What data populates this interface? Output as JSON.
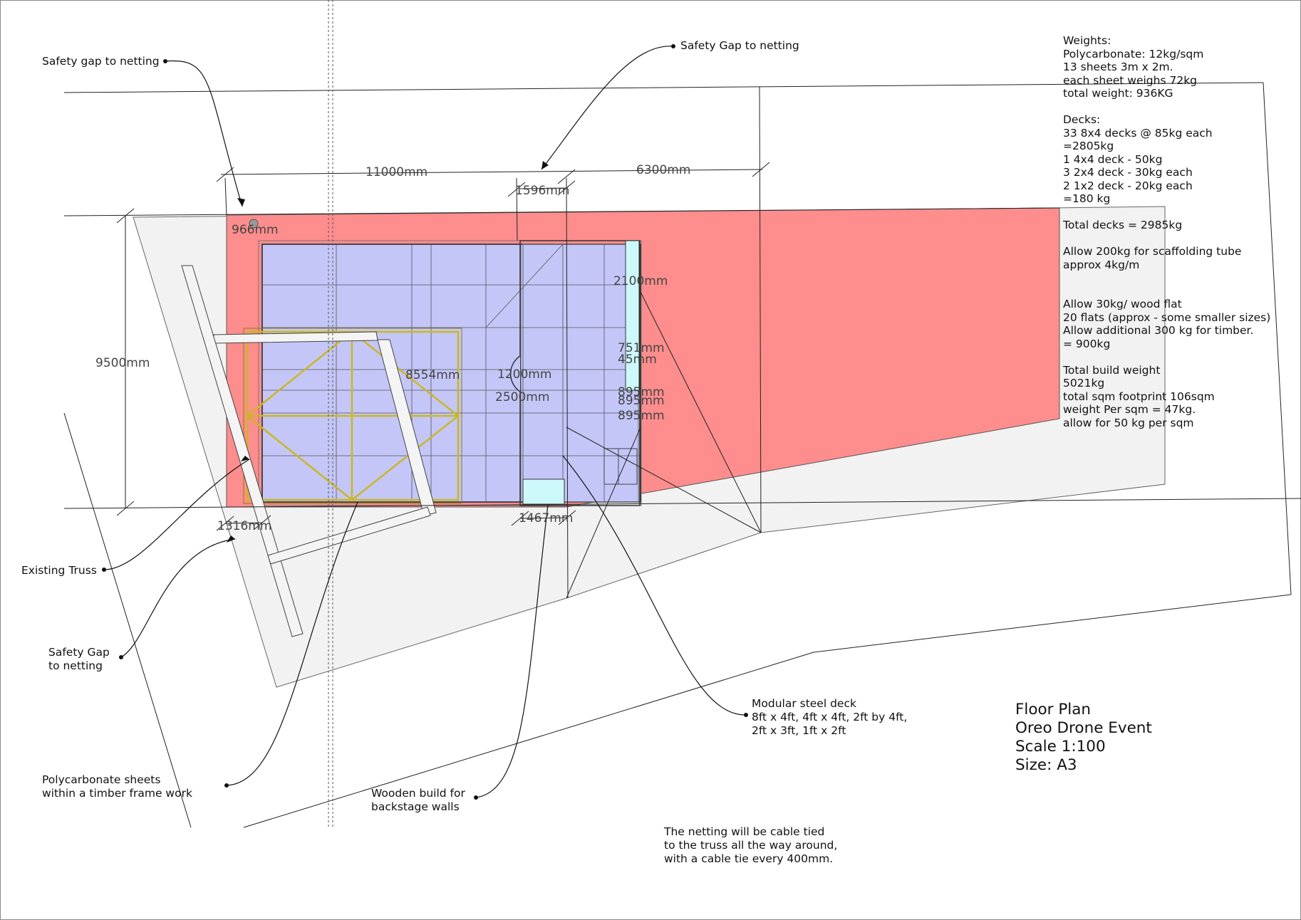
{
  "colors": {
    "deck": "#c4c6f8",
    "safety_zone": "#fe8d8d",
    "floor": "#f2f2f2",
    "truss": "#e8d84a",
    "cyan": "#ccf8fa"
  },
  "callouts": {
    "safety_gap_top_left": "Safety gap to netting",
    "safety_gap_top": "Safety Gap to netting",
    "existing_truss": "Existing Truss",
    "safety_gap_left_1": "Safety Gap",
    "safety_gap_left_2": "to netting",
    "polycarbonate_1": "Polycarbonate sheets",
    "polycarbonate_2": "within a timber frame work",
    "wooden_build_1": "Wooden build for",
    "wooden_build_2": "backstage walls",
    "modular_deck_1": "Modular steel deck",
    "modular_deck_2": "8ft x 4ft, 4ft x 4ft, 2ft by 4ft,",
    "modular_deck_3": "2ft x 3ft, 1ft x 2ft",
    "netting_note_1": "The netting will be cable tied",
    "netting_note_2": "to the truss all the way around,",
    "netting_note_3": "with a cable tie every 400mm."
  },
  "dimensions": {
    "d11000": "11000mm",
    "d6300": "6300mm",
    "d1596": "1596mm",
    "d966": "966mm",
    "d9500": "9500mm",
    "d2100": "2100mm",
    "d751": "751mm",
    "d45": "45mm",
    "d8554": "8554mm",
    "d1200": "1200mm",
    "d2500": "2500mm",
    "d895a": "895mm",
    "d895b": "895mm",
    "d895c": "895mm",
    "d1316": "1316mm",
    "d1467": "1467mm"
  },
  "weights": [
    "Weights:",
    "Polycarbonate: 12kg/sqm",
    "13 sheets 3m x 2m.",
    "each sheet weighs 72kg",
    "total weight: 936KG",
    "",
    "Decks:",
    "33 8x4 decks @ 85kg each",
    "=2805kg",
    "1 4x4 deck - 50kg",
    "3 2x4 deck - 30kg each",
    "2 1x2 deck - 20kg each",
    "=180 kg",
    "",
    "Total decks = 2985kg",
    "",
    "Allow 200kg for scaffolding tube",
    "approx 4kg/m",
    "",
    "",
    "Allow 30kg/ wood flat",
    "20 flats (approx - some smaller sizes)",
    "Allow additional 300 kg for timber.",
    "= 900kg",
    "",
    "Total build weight",
    "5021kg",
    "total sqm footprint 106sqm",
    "weight Per sqm = 47kg.",
    "allow for 50 kg per sqm"
  ],
  "title_block": [
    "Floor Plan",
    "Oreo Drone Event",
    "Scale 1:100",
    "Size: A3"
  ]
}
